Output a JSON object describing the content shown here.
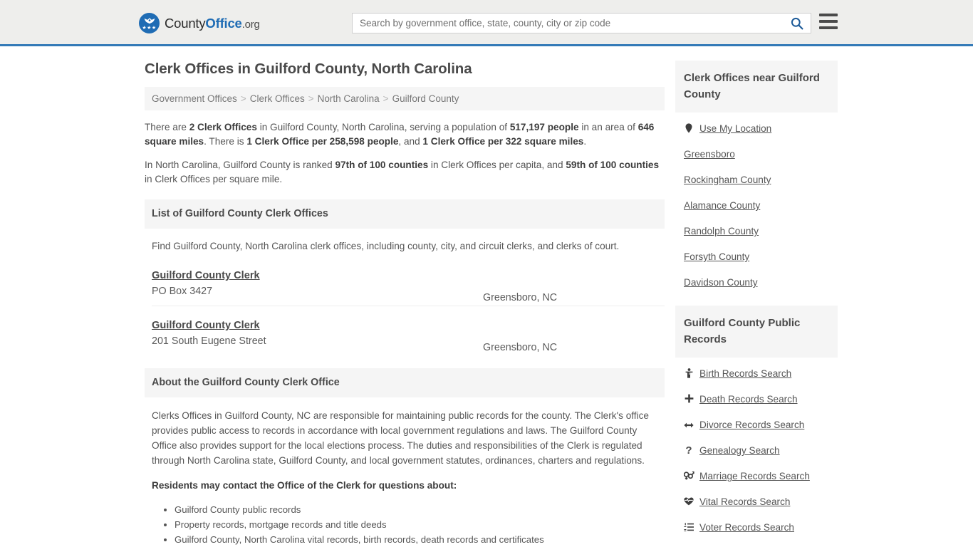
{
  "header": {
    "logo": {
      "part1": "County",
      "part2": "Office",
      "part3": ".org",
      "stars": "★★★",
      "icon": "eagle-logo-icon"
    },
    "search": {
      "placeholder": "Search by government office, state, county, city or zip code",
      "value": "",
      "button_icon": "search-icon"
    },
    "menu_icon": "hamburger-menu-icon",
    "accent_color": "#337ab7",
    "background_color": "#eeeeec"
  },
  "page": {
    "title": "Clerk Offices in Guilford County, North Carolina"
  },
  "breadcrumb": {
    "items": [
      {
        "label": "Government Offices"
      },
      {
        "label": "Clerk Offices"
      },
      {
        "label": "North Carolina"
      },
      {
        "label": "Guilford County"
      }
    ],
    "separator": ">"
  },
  "intro": {
    "p1_a": "There are ",
    "p1_b1": "2 Clerk Offices",
    "p1_c": " in Guilford County, North Carolina, serving a population of ",
    "p1_b2": "517,197 people",
    "p1_d": " in an area of ",
    "p1_b3": "646 square miles",
    "p1_e": ". There is ",
    "p1_b4": "1 Clerk Office per 258,598 people",
    "p1_f": ", and ",
    "p1_b5": "1 Clerk Office per 322 square miles",
    "p1_g": ".",
    "p2_a": "In North Carolina, Guilford County is ranked ",
    "p2_b1": "97th of 100 counties",
    "p2_c": " in Clerk Offices per capita, and ",
    "p2_b2": "59th of 100 counties",
    "p2_d": " in Clerk Offices per square mile."
  },
  "list_section": {
    "heading": "List of Guilford County Clerk Offices",
    "lead": "Find Guilford County, North Carolina clerk offices, including county, city, and circuit clerks, and clerks of court.",
    "offices": [
      {
        "name": "Guilford County Clerk",
        "address": "PO Box 3427",
        "city": "Greensboro, NC"
      },
      {
        "name": "Guilford County Clerk",
        "address": "201 South Eugene Street",
        "city": "Greensboro, NC"
      }
    ]
  },
  "about_section": {
    "heading": "About the Guilford County Clerk Office",
    "paragraph": "Clerks Offices in Guilford County, NC are responsible for maintaining public records for the county. The Clerk's office provides public access to records in accordance with local government regulations and laws. The Guilford County Office also provides support for the local elections process. The duties and responsibilities of the Clerk is regulated through North Carolina state, Guilford County, and local government statutes, ordinances, charters and regulations.",
    "subheading": "Residents may contact the Office of the Clerk for questions about:",
    "bullets": [
      "Guilford County public records",
      "Property records, mortgage records and title deeds",
      "Guilford County, North Carolina vital records, birth records, death records and certificates"
    ]
  },
  "sidebar": {
    "nearby": {
      "heading": "Clerk Offices near Guilford County",
      "items": [
        {
          "label": "Use My Location",
          "icon": "map-pin-icon",
          "glyph": "⮟"
        },
        {
          "label": "Greensboro",
          "icon": "",
          "glyph": ""
        },
        {
          "label": "Rockingham County",
          "icon": "",
          "glyph": ""
        },
        {
          "label": "Alamance County",
          "icon": "",
          "glyph": ""
        },
        {
          "label": "Randolph County",
          "icon": "",
          "glyph": ""
        },
        {
          "label": "Forsyth County",
          "icon": "",
          "glyph": ""
        },
        {
          "label": "Davidson County",
          "icon": "",
          "glyph": ""
        }
      ]
    },
    "public_records": {
      "heading": "Guilford County Public Records",
      "items": [
        {
          "label": "Birth Records Search",
          "icon": "baby-icon",
          "glyph": "♓"
        },
        {
          "label": "Death Records Search",
          "icon": "cross-icon",
          "glyph": "✚"
        },
        {
          "label": "Divorce Records Search",
          "icon": "double-arrow-icon",
          "glyph": "↔"
        },
        {
          "label": "Genealogy Search",
          "icon": "question-mark-icon",
          "glyph": "?"
        },
        {
          "label": "Marriage Records Search",
          "icon": "gender-symbols-icon",
          "glyph": "⚥"
        },
        {
          "label": "Vital Records Search",
          "icon": "heartbeat-icon",
          "glyph": "♥"
        },
        {
          "label": "Voter Records Search",
          "icon": "list-ol-icon",
          "glyph": "≡"
        }
      ]
    }
  }
}
